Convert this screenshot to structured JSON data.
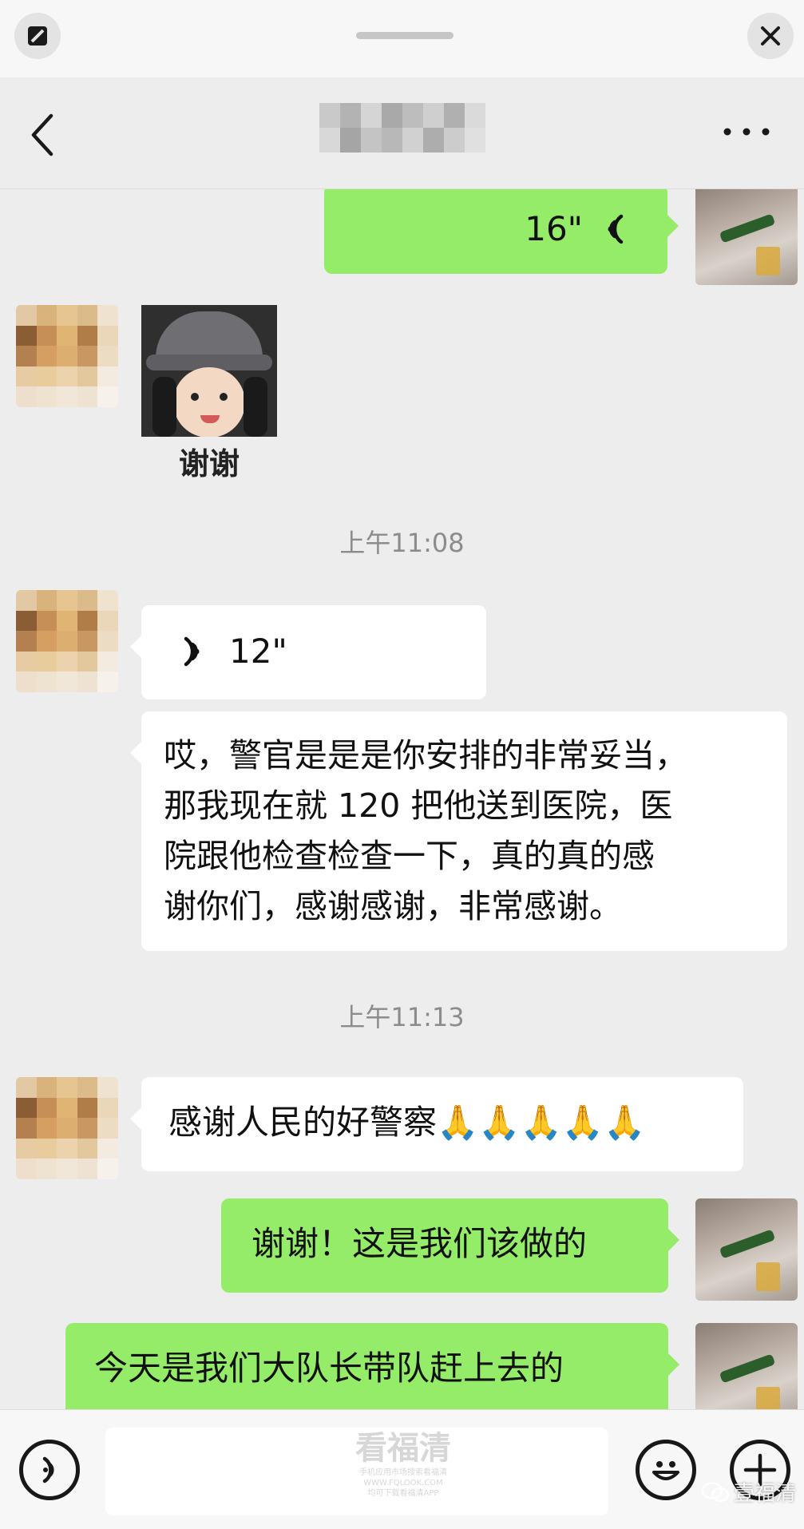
{
  "topbar": {
    "float_icon": "minimize-to-float-icon",
    "close_icon": "close-icon"
  },
  "navbar": {
    "title": "",
    "back_icon": "chevron-left-icon",
    "more_icon": "more-dots-icon"
  },
  "messages": [
    {
      "type": "voice",
      "sender": "me",
      "duration": "16\""
    },
    {
      "type": "sticker",
      "sender": "contact",
      "caption": "谢谢"
    },
    {
      "type": "time",
      "text": "上午11:08"
    },
    {
      "type": "voice",
      "sender": "contact",
      "duration": "12\""
    },
    {
      "type": "text",
      "sender": "contact",
      "lines": [
        "哎，警官是是是你安排的非常妥当，",
        "那我现在就 120 把他送到医院，医",
        "院跟他检查检查一下，真的真的感",
        "谢你们，感谢感谢，非常感谢。"
      ]
    },
    {
      "type": "time",
      "text": "上午11:13"
    },
    {
      "type": "text",
      "sender": "contact",
      "text": "感谢人民的好警察",
      "emoji": "🙏🙏🙏🙏🙏"
    },
    {
      "type": "text",
      "sender": "me",
      "text": "谢谢！这是我们该做的"
    },
    {
      "type": "text",
      "sender": "me",
      "text": "今天是我们大队长带队赶上去的"
    }
  ],
  "bottombar": {
    "voice_icon": "voice-input-icon",
    "emoji_icon": "emoji-smile-icon",
    "plus_icon": "plus-icon"
  },
  "watermark": {
    "title": "看福清",
    "line1": "手机应用市场搜索看福清",
    "line2": "WWW.FQLOOK.COM",
    "line3": "均可下载看福清APP"
  },
  "brand": {
    "name": "壹福清",
    "icon": "wechat-logo-icon"
  },
  "colors": {
    "outgoing_bubble": "#95ec69",
    "incoming_bubble": "#ffffff",
    "chat_background": "#ededed"
  }
}
